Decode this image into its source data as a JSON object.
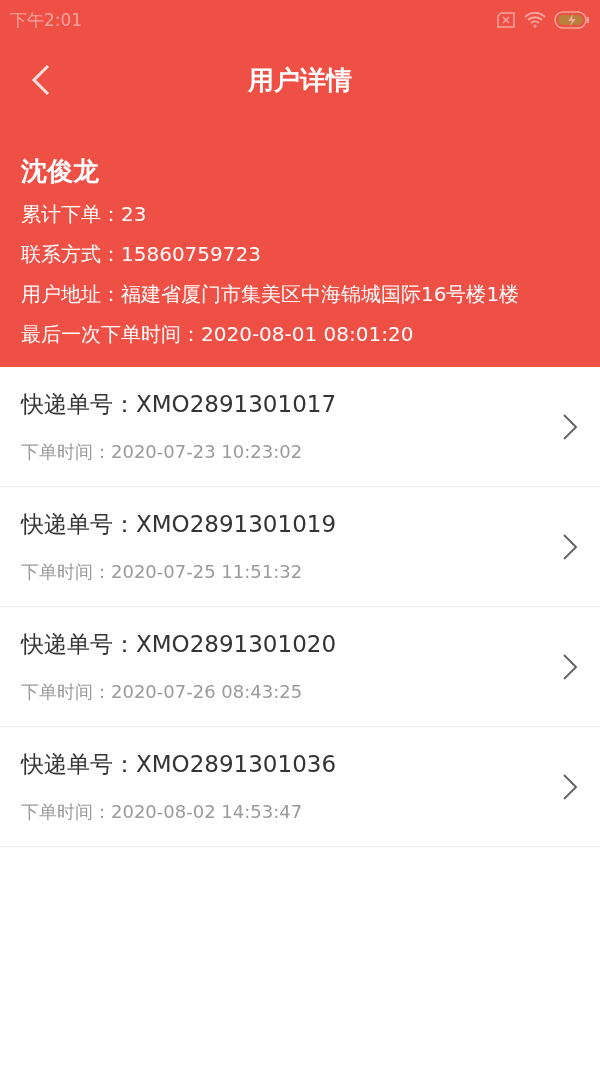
{
  "status_bar": {
    "time": "下午2:01"
  },
  "nav": {
    "title": "用户详情"
  },
  "user": {
    "name": "沈俊龙",
    "details": [
      "累计下单：23",
      "联系方式：15860759723",
      "用户地址：福建省厦门市集美区中海锦城国际16号楼1楼",
      "最后一次下单时间：2020-08-01 08:01:20"
    ]
  },
  "orders": [
    {
      "number": "快递单号：XMO2891301017",
      "time": "下单时间：2020-07-23 10:23:02"
    },
    {
      "number": "快递单号：XMO2891301019",
      "time": "下单时间：2020-07-25 11:51:32"
    },
    {
      "number": "快递单号：XMO2891301020",
      "time": "下单时间：2020-07-26 08:43:25"
    },
    {
      "number": "快递单号：XMO2891301036",
      "time": "下单时间：2020-08-02 14:53:47"
    }
  ]
}
